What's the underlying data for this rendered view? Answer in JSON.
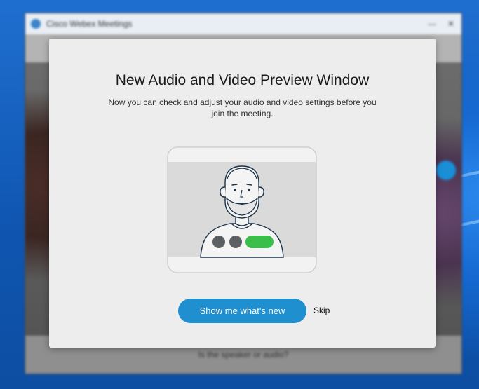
{
  "background_app": {
    "title": "Cisco Webex Meetings",
    "window_controls": [
      "—",
      "✕"
    ],
    "bottom_hint": "Is the speaker or audio?"
  },
  "modal": {
    "title": "New Audio and Video Preview Window",
    "description": "Now you can check and adjust your audio and video settings before you join the meeting.",
    "primary_button": "Show me what's new",
    "skip_label": "Skip"
  },
  "colors": {
    "accent": "#1f8fcf",
    "toggle_on": "#3bbf4a",
    "control_dot": "#5d6063",
    "modal_bg": "#ededed"
  },
  "icons": {
    "illustration": "person-video-preview-icon",
    "app_logo": "webex-logo-icon"
  }
}
